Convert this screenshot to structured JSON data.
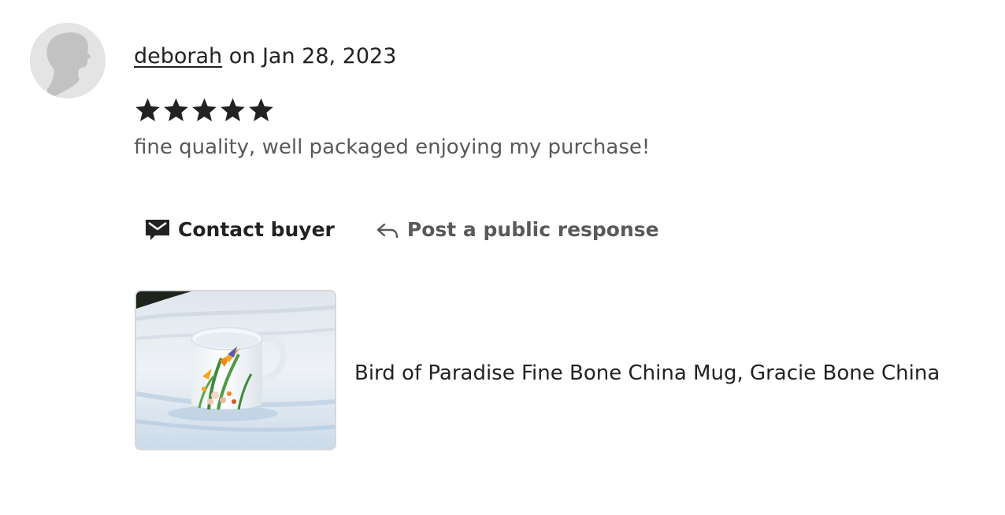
{
  "review": {
    "author": "deborah",
    "date_text": " on Jan 28, 2023",
    "rating": 5,
    "rating_max": 5,
    "text": "fine quality, well packaged enjoying my purchase!"
  },
  "actions": {
    "contact_label": "Contact buyer",
    "contact_icon": "envelope-icon",
    "respond_label": "Post a public response",
    "respond_icon": "reply-arrow-icon"
  },
  "product": {
    "title": "Bird of Paradise Fine Bone China Mug, Gracie Bone China",
    "image_alt": "Bird of Paradise Fine Bone China Mug"
  },
  "colors": {
    "text_primary": "#222222",
    "text_secondary": "#595959",
    "avatar_bg": "#e4e4e4",
    "avatar_figure": "#c2c2c2",
    "star": "#222222"
  }
}
